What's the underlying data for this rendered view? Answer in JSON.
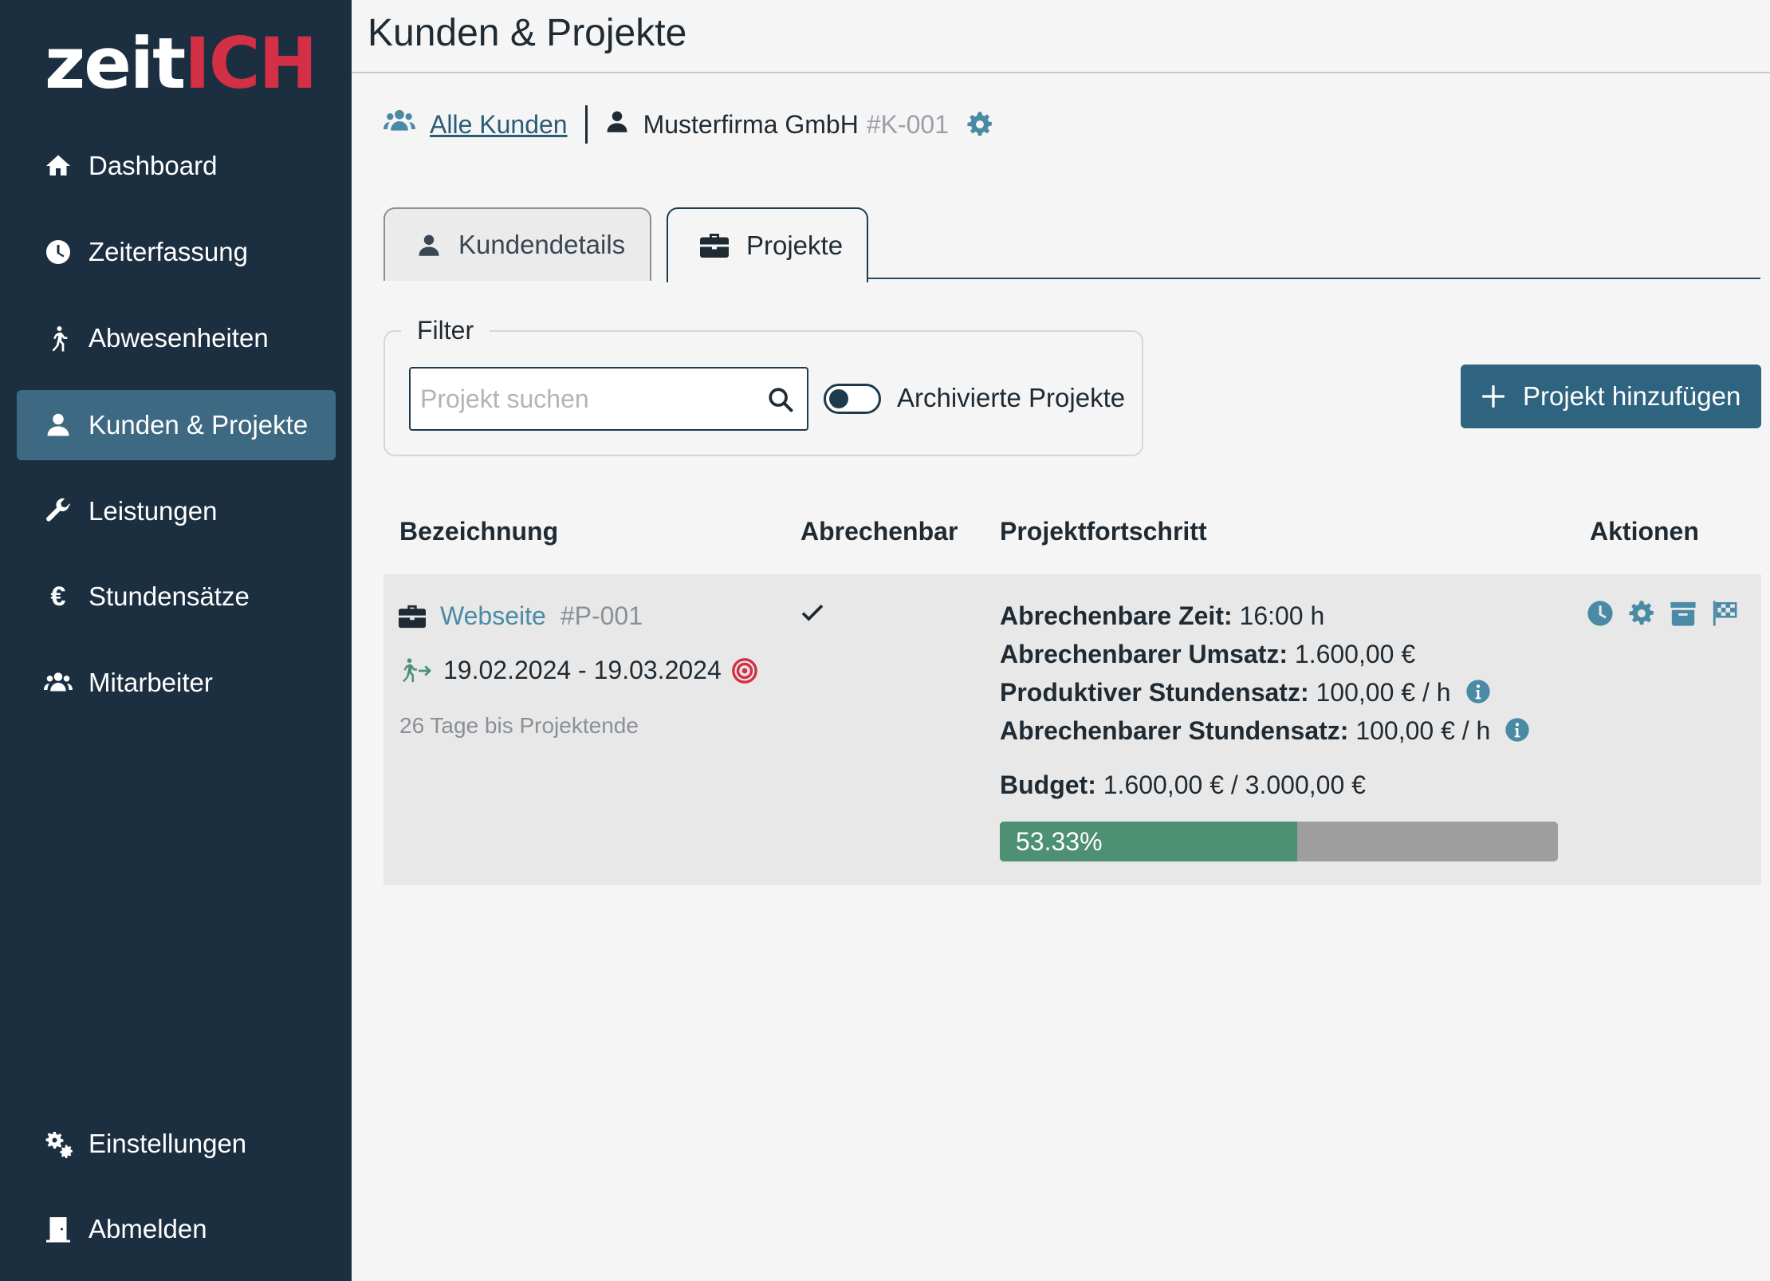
{
  "app": {
    "logo_part1": "zeit",
    "logo_part2": "ICH",
    "brand_accent": "#d32f45"
  },
  "sidebar": {
    "items": [
      {
        "label": "Dashboard",
        "icon": "home-icon"
      },
      {
        "label": "Zeiterfassung",
        "icon": "clock-icon"
      },
      {
        "label": "Abwesenheiten",
        "icon": "walking-person-icon"
      },
      {
        "label": "Kunden & Projekte",
        "icon": "user-icon",
        "active": true
      },
      {
        "label": "Leistungen",
        "icon": "wrench-icon"
      },
      {
        "label": "Stundensätze",
        "icon": "euro-icon"
      },
      {
        "label": "Mitarbeiter",
        "icon": "users-icon"
      }
    ],
    "bottom_items": [
      {
        "label": "Einstellungen",
        "icon": "gears-icon"
      },
      {
        "label": "Abmelden",
        "icon": "door-icon"
      }
    ]
  },
  "header": {
    "title": "Kunden & Projekte"
  },
  "breadcrumb": {
    "all_customers": "Alle Kunden",
    "customer_name": "Musterfirma GmbH",
    "customer_id": "#K-001"
  },
  "tabs": [
    {
      "label": "Kundendetails",
      "active": false
    },
    {
      "label": "Projekte",
      "active": true
    }
  ],
  "filter": {
    "legend": "Filter",
    "search_placeholder": "Projekt suchen",
    "search_value": "",
    "toggle_label": "Archivierte Projekte",
    "toggle_on": false
  },
  "add_button": {
    "label": "Projekt hinzufügen"
  },
  "table": {
    "headers": [
      "Bezeichnung",
      "Abrechenbar",
      "Projektfortschritt",
      "Aktionen"
    ],
    "rows": [
      {
        "name": "Webseite",
        "id": "#P-001",
        "date_range": "19.02.2024 - 19.03.2024",
        "remaining": "26 Tage bis Projektende",
        "billable": true,
        "progress": {
          "time_label": "Abrechenbare Zeit:",
          "time_value": "16:00 h",
          "revenue_label": "Abrechenbarer Umsatz:",
          "revenue_value": "1.600,00 €",
          "prod_rate_label": "Produktiver Stundensatz:",
          "prod_rate_value": "100,00 € / h",
          "bill_rate_label": "Abrechenbarer Stundensatz:",
          "bill_rate_value": "100,00 € / h",
          "budget_label": "Budget:",
          "budget_value": "1.600,00 € / 3.000,00 €",
          "percent_text": "53.33%",
          "percent": 53.33
        },
        "actions": [
          "clock-icon",
          "gear-icon",
          "archive-icon",
          "flag-checkered-icon"
        ]
      }
    ]
  }
}
